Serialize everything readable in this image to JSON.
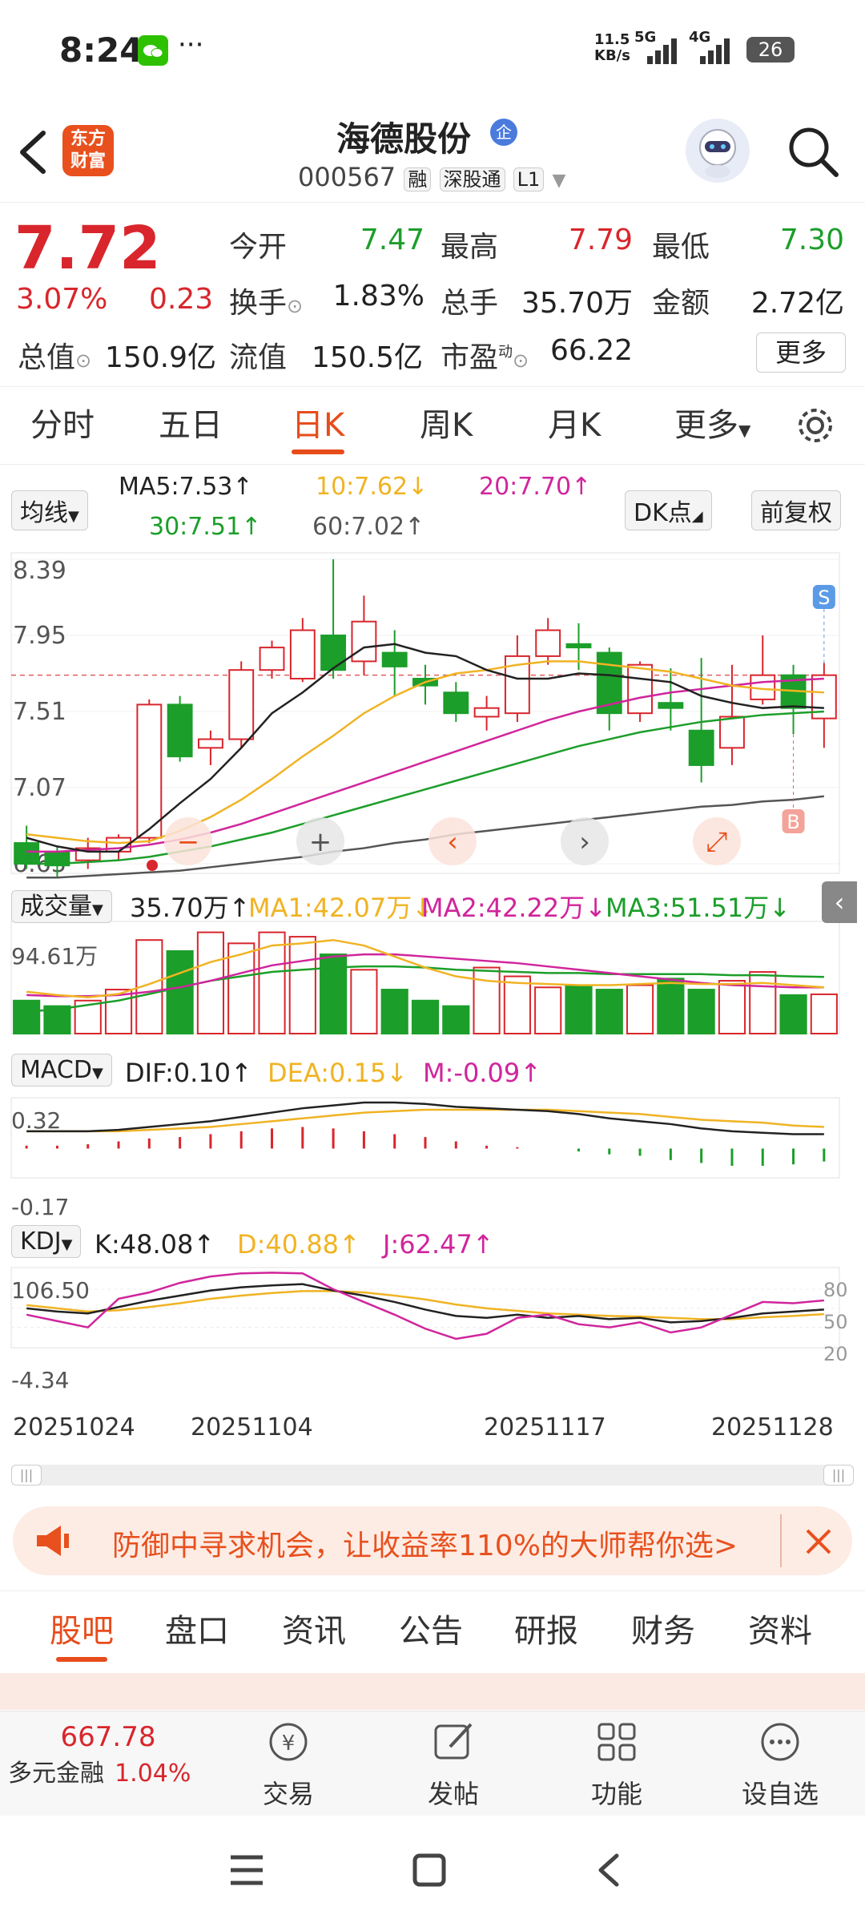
{
  "status": {
    "time": "8:24",
    "net_speed_top": "11.5",
    "net_speed_bottom": "KB/s",
    "sig1": "5G",
    "sig2": "4G",
    "battery": "26"
  },
  "header": {
    "logo_line1": "东方",
    "logo_line2": "财富",
    "stock_name": "海德股份",
    "stock_badge": "企",
    "stock_code": "000567",
    "tag1": "融",
    "tag2": "深股通",
    "tag3": "L1"
  },
  "quote": {
    "price": "7.72",
    "change_pct": "3.07%",
    "change": "0.23",
    "open_label": "今开",
    "open": "7.47",
    "high_label": "最高",
    "high": "7.79",
    "low_label": "最低",
    "low": "7.30",
    "turnover_label": "换手",
    "turnover": "1.83%",
    "volume_label": "总手",
    "volume": "35.70万",
    "amount_label": "金额",
    "amount": "2.72亿",
    "mktcap_label": "总值",
    "mktcap": "150.9亿",
    "float_label": "流值",
    "float": "150.5亿",
    "pe_label": "市盈",
    "pe_sup": "动",
    "pe": "66.22",
    "more": "更多"
  },
  "tabs": [
    "分时",
    "五日",
    "日K",
    "周K",
    "月K",
    "更多"
  ],
  "active_tab": "日K",
  "ma_bar": {
    "selector": "均线",
    "ma5": "MA5:7.53",
    "ma10": "10:7.62",
    "ma20": "20:7.70",
    "ma30": "30:7.51",
    "ma60": "60:7.02",
    "dk": "DK点",
    "fq": "前复权"
  },
  "kline": {
    "y_labels": [
      "8.39",
      "7.95",
      "7.51",
      "7.07",
      "6.63"
    ],
    "buy_marker": "B",
    "sell_marker": "S"
  },
  "volume": {
    "selector": "成交量",
    "value": "35.70万",
    "ma1": "MA1:42.07万",
    "ma2": "MA2:42.22万",
    "ma3": "MA3:51.51万",
    "y_label": "94.61万"
  },
  "macd": {
    "selector": "MACD",
    "dif": "DIF:0.10",
    "dea": "DEA:0.15",
    "m": "M:-0.09",
    "y_top": "0.32",
    "y_bottom": "-0.17"
  },
  "kdj": {
    "selector": "KDJ",
    "k": "K:48.08",
    "d": "D:40.88",
    "j": "J:62.47",
    "y_top": "106.50",
    "y_bottom": "-4.34",
    "levels": [
      "80",
      "50",
      "20"
    ]
  },
  "dates": [
    "20251024",
    "20251104",
    "20251117",
    "20251128"
  ],
  "banner": {
    "text": "防御中寻求机会，让收益率110%的大师帮你选>"
  },
  "bottom_tabs": [
    "股吧",
    "盘口",
    "资讯",
    "公告",
    "研报",
    "财务",
    "资料"
  ],
  "footer": {
    "index_value": "667.78",
    "index_name": "多元金融",
    "index_pct": "1.04%",
    "trade": "交易",
    "post": "发帖",
    "func": "功能",
    "watch": "设自选"
  },
  "colors": {
    "red": "#d8262c",
    "green": "#1c9e2a",
    "accent": "#e74c1b",
    "ma5": "#222222",
    "ma10": "#f0b323",
    "ma20": "#d0259c",
    "ma30": "#1c9e2a",
    "ma60": "#555555"
  },
  "chart_data": {
    "type": "candlestick",
    "y_range": [
      6.63,
      8.39
    ],
    "candles": [
      {
        "o": 6.75,
        "c": 6.63,
        "h": 6.85,
        "l": 6.6
      },
      {
        "o": 6.7,
        "c": 6.62,
        "h": 6.73,
        "l": 6.55
      },
      {
        "o": 6.65,
        "c": 6.72,
        "h": 6.78,
        "l": 6.6
      },
      {
        "o": 6.7,
        "c": 6.78,
        "h": 6.8,
        "l": 6.65
      },
      {
        "o": 6.78,
        "c": 7.55,
        "h": 7.58,
        "l": 6.75
      },
      {
        "o": 7.55,
        "c": 7.25,
        "h": 7.6,
        "l": 7.22
      },
      {
        "o": 7.3,
        "c": 7.35,
        "h": 7.4,
        "l": 7.2
      },
      {
        "o": 7.35,
        "c": 7.75,
        "h": 7.8,
        "l": 7.3
      },
      {
        "o": 7.75,
        "c": 7.88,
        "h": 7.92,
        "l": 7.7
      },
      {
        "o": 7.7,
        "c": 7.98,
        "h": 8.05,
        "l": 7.68
      },
      {
        "o": 7.95,
        "c": 7.75,
        "h": 8.39,
        "l": 7.7
      },
      {
        "o": 7.8,
        "c": 8.03,
        "h": 8.18,
        "l": 7.72
      },
      {
        "o": 7.85,
        "c": 7.77,
        "h": 7.98,
        "l": 7.6
      },
      {
        "o": 7.7,
        "c": 7.66,
        "h": 7.78,
        "l": 7.55
      },
      {
        "o": 7.62,
        "c": 7.5,
        "h": 7.68,
        "l": 7.45
      },
      {
        "o": 7.48,
        "c": 7.53,
        "h": 7.6,
        "l": 7.4
      },
      {
        "o": 7.5,
        "c": 7.83,
        "h": 7.95,
        "l": 7.45
      },
      {
        "o": 7.83,
        "c": 7.98,
        "h": 8.05,
        "l": 7.78
      },
      {
        "o": 7.9,
        "c": 7.88,
        "h": 8.02,
        "l": 7.75
      },
      {
        "o": 7.85,
        "c": 7.5,
        "h": 7.88,
        "l": 7.4
      },
      {
        "o": 7.5,
        "c": 7.78,
        "h": 7.8,
        "l": 7.45
      },
      {
        "o": 7.56,
        "c": 7.53,
        "h": 7.76,
        "l": 7.4
      },
      {
        "o": 7.4,
        "c": 7.2,
        "h": 7.82,
        "l": 7.1
      },
      {
        "o": 7.3,
        "c": 7.48,
        "h": 7.78,
        "l": 7.2
      },
      {
        "o": 7.58,
        "c": 7.72,
        "h": 7.95,
        "l": 7.55
      },
      {
        "o": 7.72,
        "c": 7.53,
        "h": 7.78,
        "l": 7.38
      },
      {
        "o": 7.47,
        "c": 7.72,
        "h": 7.79,
        "l": 7.3
      }
    ],
    "ma5": [
      6.78,
      6.73,
      6.7,
      6.7,
      6.83,
      6.98,
      7.12,
      7.3,
      7.5,
      7.62,
      7.76,
      7.88,
      7.9,
      7.85,
      7.83,
      7.75,
      7.7,
      7.7,
      7.73,
      7.72,
      7.7,
      7.68,
      7.6,
      7.56,
      7.53,
      7.54,
      7.53
    ],
    "ma10": [
      6.8,
      6.78,
      6.76,
      6.75,
      6.76,
      6.82,
      6.9,
      7.0,
      7.12,
      7.25,
      7.37,
      7.5,
      7.6,
      7.68,
      7.73,
      7.75,
      7.78,
      7.8,
      7.8,
      7.78,
      7.76,
      7.74,
      7.7,
      7.66,
      7.64,
      7.63,
      7.62
    ],
    "ma20": [
      6.7,
      6.7,
      6.71,
      6.72,
      6.74,
      6.77,
      6.81,
      6.86,
      6.92,
      6.98,
      7.04,
      7.1,
      7.16,
      7.22,
      7.28,
      7.34,
      7.4,
      7.46,
      7.51,
      7.55,
      7.59,
      7.62,
      7.64,
      7.66,
      7.68,
      7.69,
      7.7
    ],
    "ma30": [
      6.63,
      6.63,
      6.64,
      6.65,
      6.67,
      6.7,
      6.73,
      6.77,
      6.81,
      6.86,
      6.91,
      6.96,
      7.01,
      7.06,
      7.11,
      7.16,
      7.21,
      7.26,
      7.31,
      7.35,
      7.39,
      7.42,
      7.45,
      7.47,
      7.49,
      7.5,
      7.51
    ],
    "ma60": [
      6.55,
      6.55,
      6.56,
      6.57,
      6.58,
      6.59,
      6.61,
      6.63,
      6.65,
      6.67,
      6.7,
      6.72,
      6.75,
      6.77,
      6.8,
      6.82,
      6.84,
      6.86,
      6.88,
      6.9,
      6.92,
      6.94,
      6.96,
      6.97,
      6.99,
      7.0,
      7.02
    ],
    "volume_range": [
      0,
      94.61
    ],
    "volumes": [
      30,
      25,
      30,
      40,
      85,
      75,
      92,
      82,
      92,
      88,
      72,
      58,
      40,
      30,
      25,
      60,
      52,
      42,
      43,
      40,
      44,
      50,
      40,
      48,
      56,
      35,
      35.7
    ],
    "vol_ma1": [
      38,
      35,
      33,
      36,
      45,
      55,
      65,
      72,
      80,
      82,
      85,
      80,
      70,
      60,
      52,
      48,
      46,
      45,
      44,
      44,
      45,
      46,
      45,
      45,
      46,
      44,
      42
    ],
    "vol_ma2": [
      35,
      34,
      34,
      35,
      38,
      42,
      48,
      55,
      62,
      66,
      70,
      72,
      72,
      70,
      68,
      66,
      64,
      61,
      58,
      55,
      52,
      49,
      46,
      44,
      43,
      42,
      42
    ],
    "vol_ma3": [
      20,
      22,
      26,
      30,
      36,
      42,
      48,
      52,
      56,
      58,
      60,
      61,
      61,
      60,
      58,
      57,
      56,
      55,
      55,
      54,
      54,
      54,
      54,
      53,
      53,
      52,
      51.5
    ],
    "macd_range": [
      -0.17,
      0.32
    ],
    "macd_dif": [
      0.12,
      0.12,
      0.12,
      0.13,
      0.15,
      0.17,
      0.19,
      0.22,
      0.25,
      0.28,
      0.3,
      0.32,
      0.32,
      0.31,
      0.29,
      0.28,
      0.27,
      0.26,
      0.24,
      0.21,
      0.19,
      0.17,
      0.14,
      0.12,
      0.11,
      0.1,
      0.1
    ],
    "macd_dea": [
      0.12,
      0.12,
      0.12,
      0.12,
      0.13,
      0.14,
      0.15,
      0.17,
      0.19,
      0.21,
      0.23,
      0.25,
      0.26,
      0.27,
      0.27,
      0.27,
      0.27,
      0.27,
      0.26,
      0.25,
      0.24,
      0.22,
      0.2,
      0.19,
      0.18,
      0.16,
      0.15
    ],
    "macd_m": [
      0.02,
      0.02,
      0.03,
      0.05,
      0.07,
      0.08,
      0.1,
      0.12,
      0.14,
      0.15,
      0.14,
      0.12,
      0.1,
      0.08,
      0.05,
      0.02,
      0.01,
      0.0,
      -0.02,
      -0.04,
      -0.05,
      -0.08,
      -0.1,
      -0.12,
      -0.12,
      -0.11,
      -0.09
    ],
    "kdj_range": [
      -4.34,
      106.5
    ],
    "kdj_k": [
      50,
      45,
      42,
      52,
      62,
      70,
      78,
      83,
      86,
      88,
      78,
      70,
      60,
      48,
      38,
      35,
      40,
      35,
      38,
      33,
      35,
      28,
      30,
      35,
      42,
      45,
      48.08
    ],
    "kdj_d": [
      55,
      50,
      45,
      47,
      52,
      58,
      65,
      70,
      74,
      77,
      77,
      75,
      70,
      64,
      56,
      50,
      46,
      42,
      40,
      38,
      37,
      35,
      33,
      33,
      36,
      38,
      40.88
    ],
    "kdj_j": [
      40,
      30,
      20,
      65,
      75,
      90,
      100,
      105,
      106,
      105,
      80,
      60,
      40,
      18,
      2,
      10,
      35,
      40,
      25,
      20,
      28,
      12,
      20,
      40,
      60,
      58,
      62.47
    ]
  }
}
